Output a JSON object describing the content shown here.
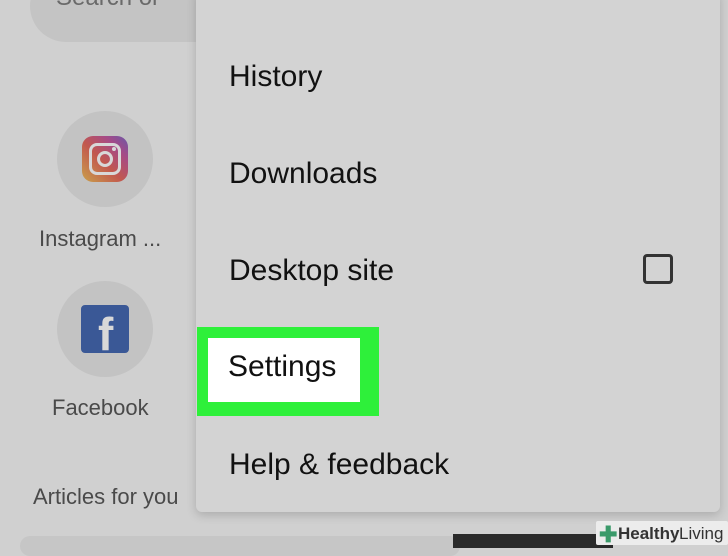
{
  "background": {
    "search_placeholder": "Search or",
    "shortcuts": [
      {
        "label": "Instagram ...",
        "icon": "instagram-icon"
      },
      {
        "label": "Facebook",
        "icon": "facebook-icon"
      }
    ],
    "section_title": "Articles for you"
  },
  "menu": {
    "items": [
      {
        "label": "History"
      },
      {
        "label": "Downloads"
      },
      {
        "label": "Desktop site",
        "checkbox": false
      },
      {
        "label": "Settings",
        "highlighted": true,
        "highlight_color": "#2ef03a"
      },
      {
        "label": "Help & feedback"
      }
    ]
  },
  "watermark": {
    "brand_bold": "Healthy",
    "brand_rest": "Living"
  }
}
